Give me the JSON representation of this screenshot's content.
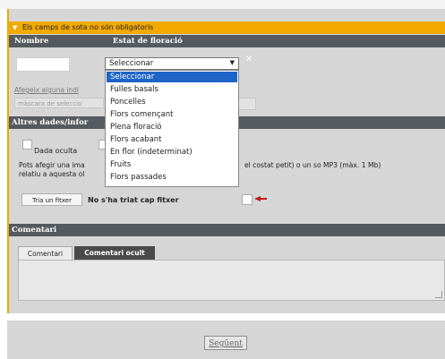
{
  "notice": "Els camps de sota no són obligatoris",
  "header": {
    "col_name": "Nombre",
    "col_state": "Estat de floració"
  },
  "select": {
    "value": "Seleccionar",
    "options": [
      "Seleccionar",
      "Fulles basals",
      "Poncelles",
      "Flors començant",
      "Plena floració",
      "Flors acabant",
      "En flor (indeterminat)",
      "Fruits",
      "Flors passades"
    ],
    "selected_index": 0
  },
  "add_link": "Afegeix alguna indi",
  "mask_placeholder": "màscara de seleccio",
  "section_other": "Altres dades/infor",
  "hidden_data_label": "Dada oculta",
  "para": {
    "line1_left": "Pots afegir una ima",
    "line1_right": "el costat petit) o un so MP3 (màx. 1 Mb)",
    "line2": "relatiu a aquesta ol"
  },
  "file": {
    "button": "Tria un fitxer",
    "status": "No s'ha triat cap fitxer"
  },
  "comments": {
    "title": "Comentari",
    "tab_comment": "Comentari",
    "tab_hidden": "Comentari ocult"
  },
  "next_button": "Següent",
  "colors": {
    "accent": "#f2a900",
    "header": "#555a60",
    "selected": "#1e64c8"
  }
}
